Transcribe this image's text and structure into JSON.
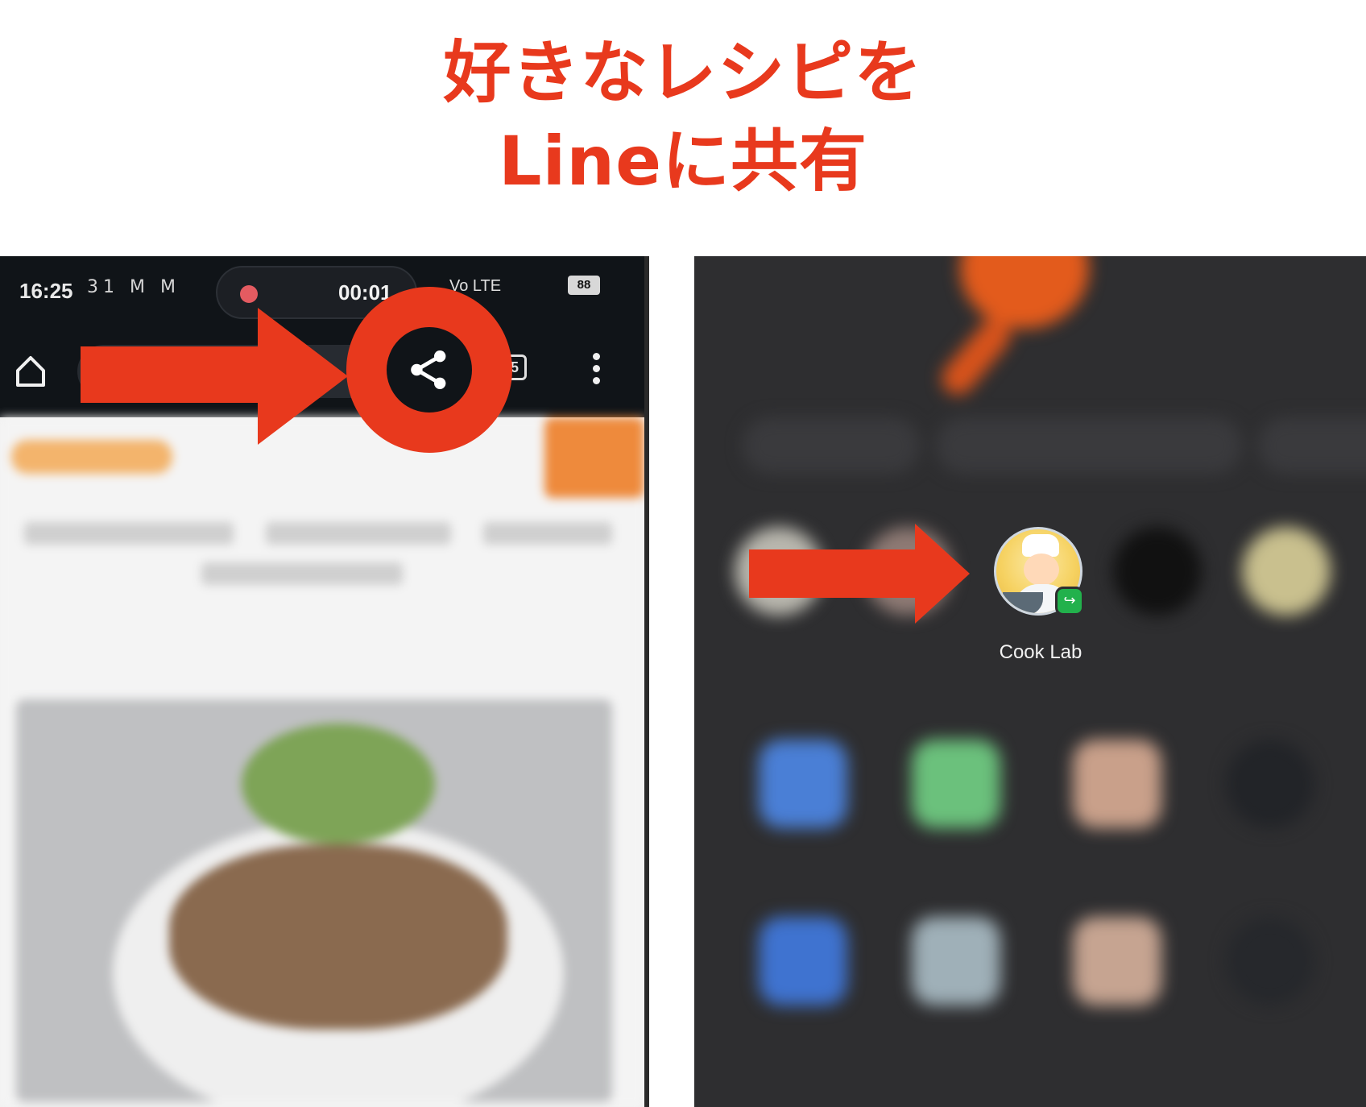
{
  "headline": {
    "line1": "好きなレシピを",
    "line2": "Lineに共有"
  },
  "left_phone": {
    "status_bar": {
      "time": "16:25",
      "notification_icons": "31 M M",
      "recording_time": "00:01",
      "battery_level": "88",
      "network_label": "Vo LTE"
    },
    "browser_toolbar": {
      "tab_count": "5",
      "icons": [
        "home-icon",
        "share-icon",
        "tabs-icon",
        "more-vert-icon"
      ]
    }
  },
  "right_phone": {
    "share_target_label": "Cook Lab",
    "share_target_badge": "line-app-icon"
  },
  "colors": {
    "accent_red": "#E8391D",
    "dark_toolbar": "#101418",
    "share_sheet_bg": "#2e2e30",
    "line_green": "#22b14c"
  }
}
